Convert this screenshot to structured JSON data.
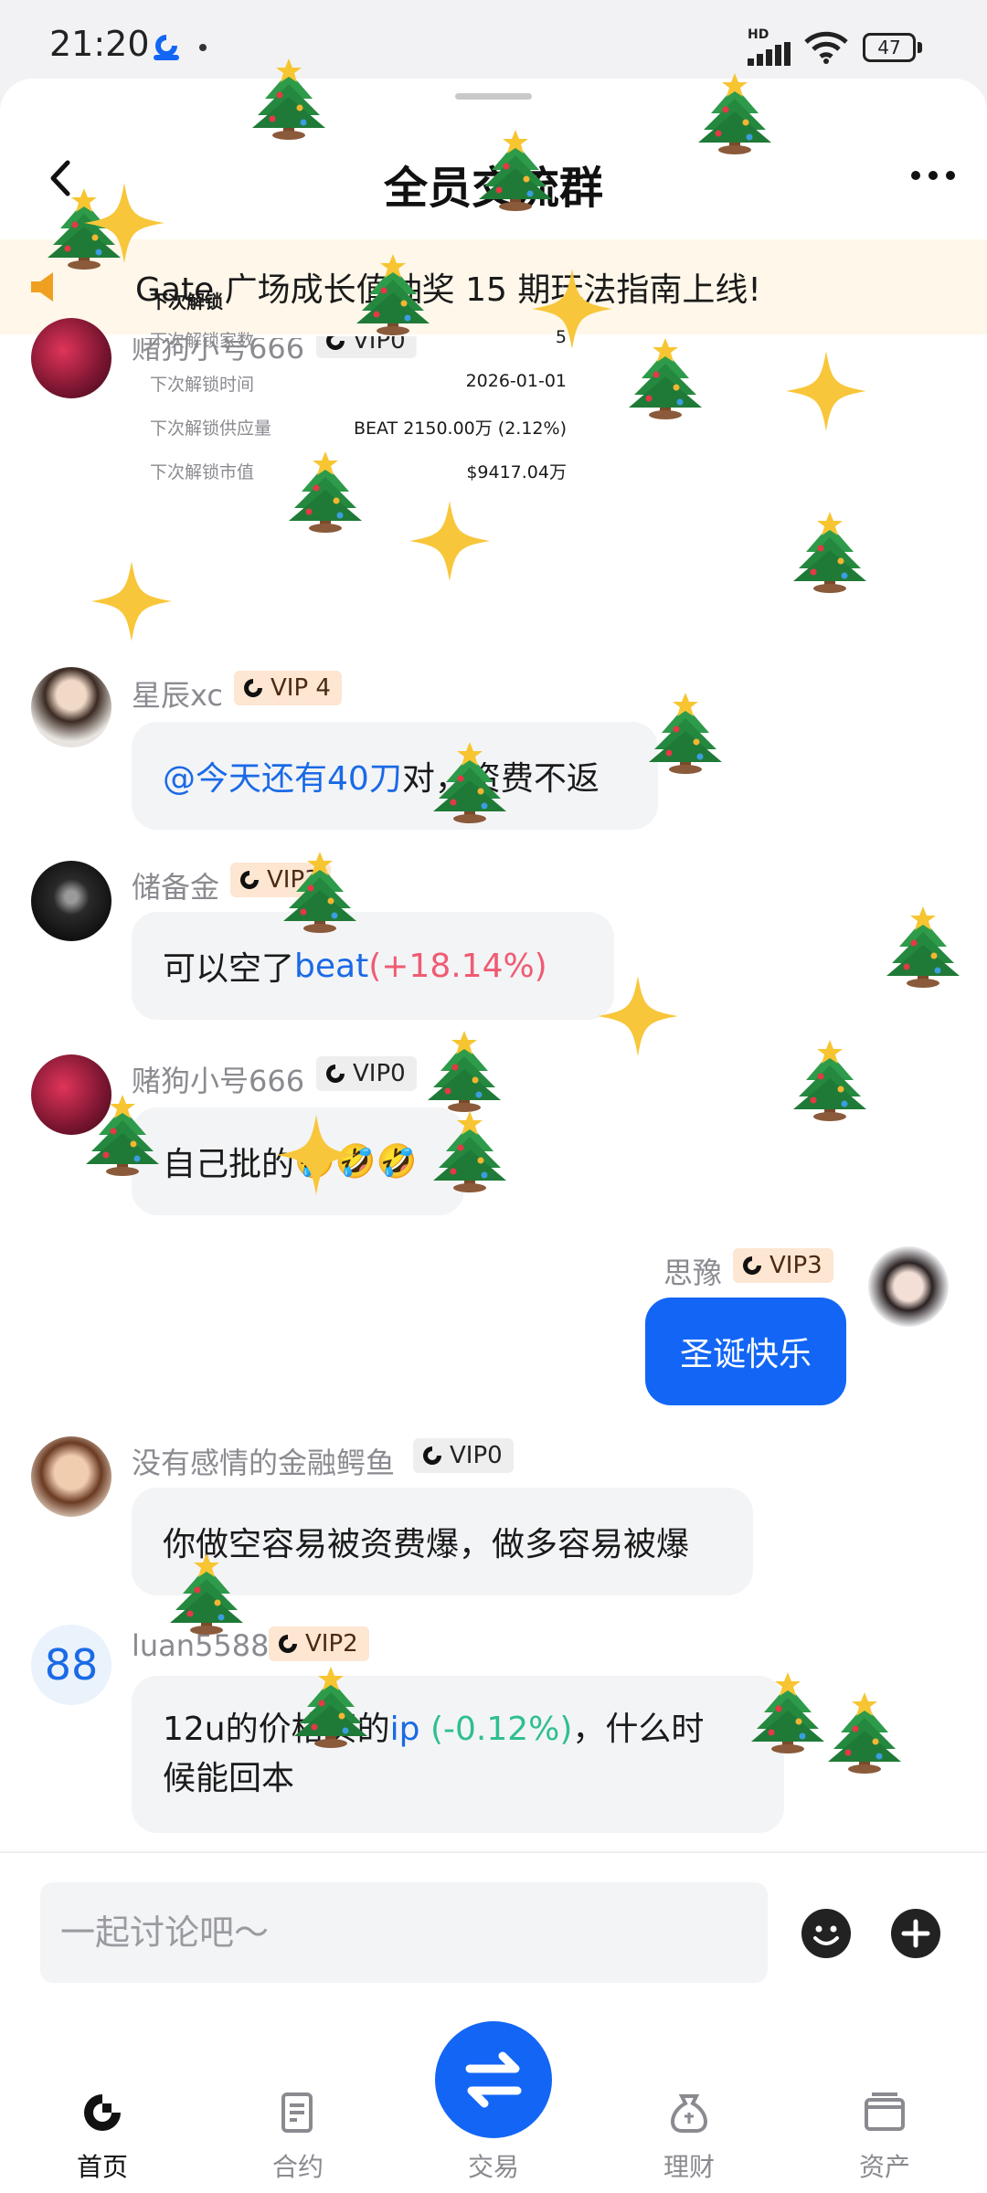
{
  "status_bar": {
    "time": "21:20",
    "network": "HD",
    "battery": "47"
  },
  "header": {
    "title": "全员交流群"
  },
  "notice": {
    "text": "Gate 广场成长值抽奖 15 期玩法指南上线!"
  },
  "unlock_card": {
    "title": "下次解锁",
    "rows": [
      {
        "key": "下次解锁家数",
        "value": "5"
      },
      {
        "key": "下次解锁时间",
        "value": "2026-01-01"
      },
      {
        "key": "下次解锁供应量",
        "value": "BEAT 2150.00万 (2.12%)"
      },
      {
        "key": "下次解锁市值",
        "value": "$9417.04万"
      }
    ]
  },
  "messages": [
    {
      "user": "赌狗小号666",
      "vip": "VIP0"
    },
    {
      "user": "星辰xc",
      "vip": "VIP 4",
      "mention": "@今天还有40刀",
      "text": " 对，资费不返"
    },
    {
      "user": "储备金",
      "vip": "VIP3",
      "text": "可以空了",
      "ticker": "beat",
      "change": " (+18.14%)"
    },
    {
      "user": "赌狗小号666",
      "vip": "VIP0",
      "text": "自己批的",
      "emoji": "🤣🤣🤣"
    },
    {
      "user": "思豫",
      "vip": "VIP3",
      "text": "圣诞快乐"
    },
    {
      "user": "没有感情的金融鳄鱼",
      "vip": "VIP0",
      "text": "你做空容易被资费爆，做多容易被爆"
    },
    {
      "user": "luan5588",
      "vip": "VIP2",
      "avatar_text": "88",
      "text_before": "12u的价格买的",
      "ticker": "ip",
      "change": " (-0.12%)",
      "text_after": "，什么时",
      "text_line2": "候能回本"
    }
  ],
  "input": {
    "placeholder": "一起讨论吧～"
  },
  "nav": {
    "items": [
      {
        "label": "首页",
        "icon": "home-icon"
      },
      {
        "label": "合约",
        "icon": "contract-icon"
      },
      {
        "label": "交易",
        "icon": "swap-icon"
      },
      {
        "label": "理财",
        "icon": "finance-icon"
      },
      {
        "label": "资产",
        "icon": "wallet-icon"
      }
    ]
  },
  "colors": {
    "accent": "#1366f5",
    "link": "#1a6ae6",
    "up": "#ef5b72",
    "down": "#2fbf8e",
    "notice_bg": "#fff7ea"
  }
}
